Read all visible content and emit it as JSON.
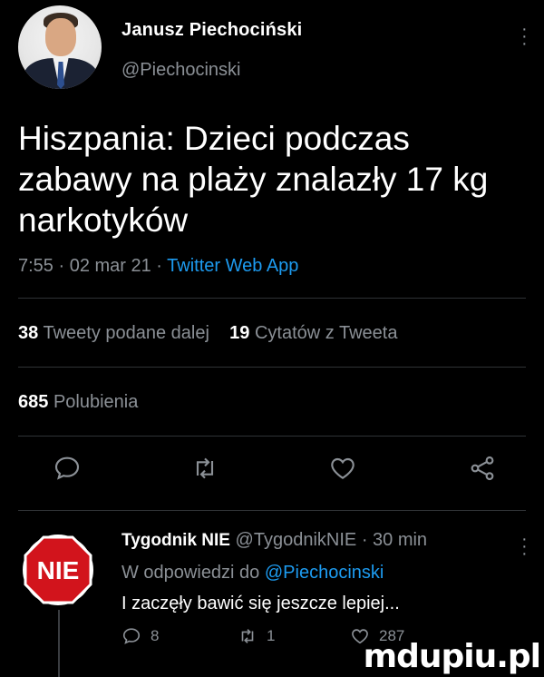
{
  "tweet": {
    "author_name": "Janusz Piechociński",
    "author_handle": "@Piechocinski",
    "text": "Hiszpania: Dzieci podczas zabawy na plaży znalazły 17 kg narkotyków",
    "time": "7:55 · 02 mar 21 · ",
    "app": "Twitter Web App",
    "retweets_count": "38",
    "retweets_label": "Tweety podane dalej",
    "quotes_count": "19",
    "quotes_label": "Cytatów z Tweeta",
    "likes_count": "685",
    "likes_label": "Polubienia"
  },
  "actions": {
    "icons": [
      "reply-icon",
      "retweet-icon",
      "like-icon",
      "share-icon"
    ]
  },
  "reply": {
    "author_name": "Tygodnik NIE",
    "author_handle": "@TygodnikNIE",
    "time": "· 30 min",
    "reply_prefix": "W odpowiedzi do ",
    "reply_mention": "@Piechocinski",
    "text": "I zaczęły bawić się jeszcze lepiej...",
    "reply_count": "8",
    "retweet_count": "1",
    "like_count": "287",
    "logo_text": "NIE"
  },
  "watermark": "mdupiu.pl",
  "colors": {
    "background": "#000000",
    "text": "#ffffff",
    "muted": "#8b9096",
    "link": "#1d9bf0",
    "logo_red": "#d2141c"
  }
}
